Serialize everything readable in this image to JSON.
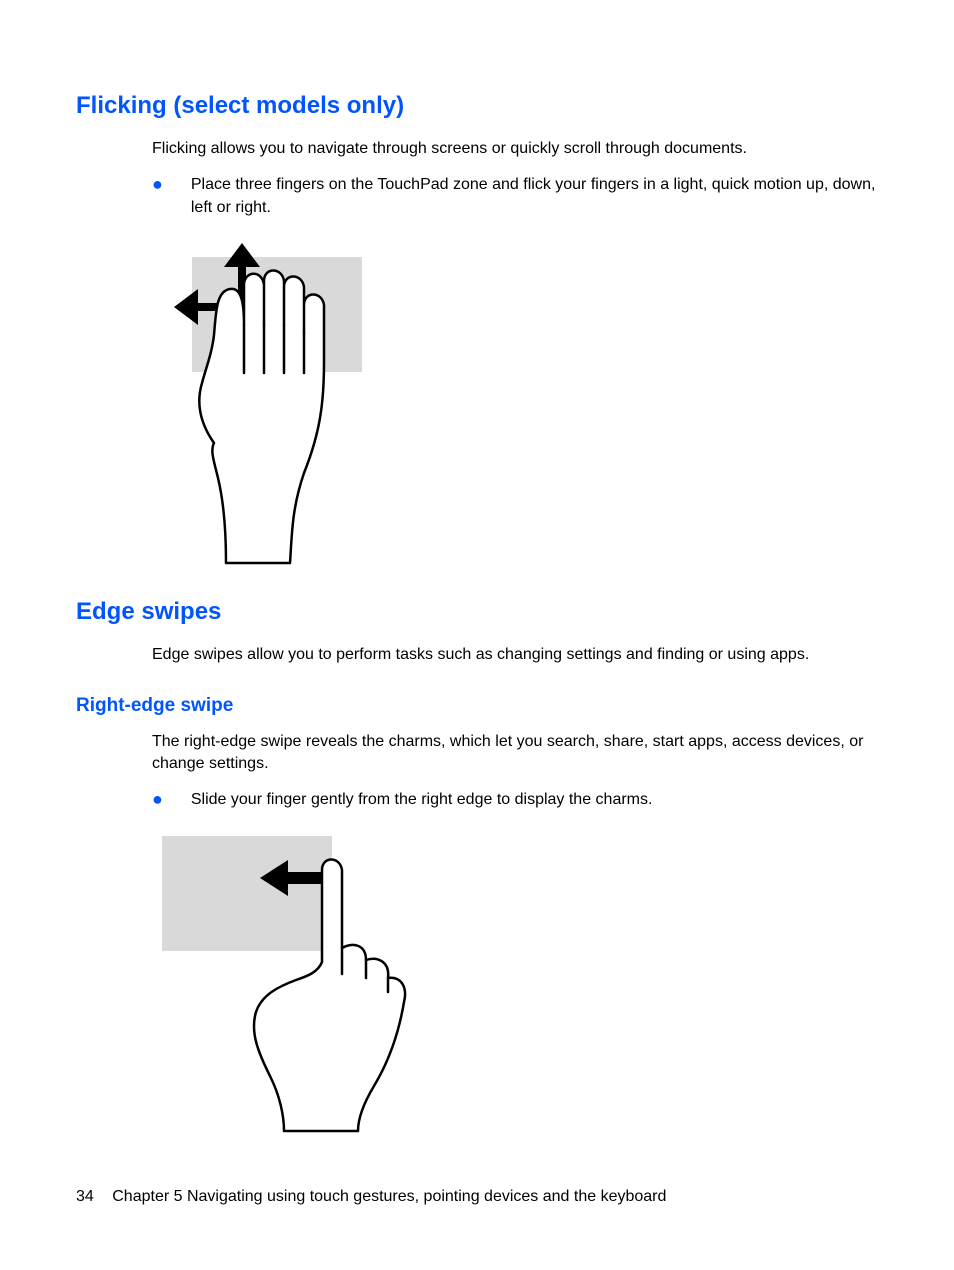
{
  "sections": {
    "flicking": {
      "heading": "Flicking (select models only)",
      "intro": "Flicking allows you to navigate through screens or quickly scroll through documents.",
      "bullet": "Place three fingers on the TouchPad zone and flick your fingers in a light, quick motion up, down, left or right."
    },
    "edge_swipes": {
      "heading": "Edge swipes",
      "intro": "Edge swipes allow you to perform tasks such as changing settings and finding or using apps."
    },
    "right_edge": {
      "heading": "Right-edge swipe",
      "intro": "The right-edge swipe reveals the charms, which let you search, share, start apps, access devices, or change settings.",
      "bullet": "Slide your finger gently from the right edge to display the charms."
    }
  },
  "footer": {
    "page_number": "34",
    "chapter": "Chapter 5   Navigating using touch gestures, pointing devices and the keyboard"
  }
}
